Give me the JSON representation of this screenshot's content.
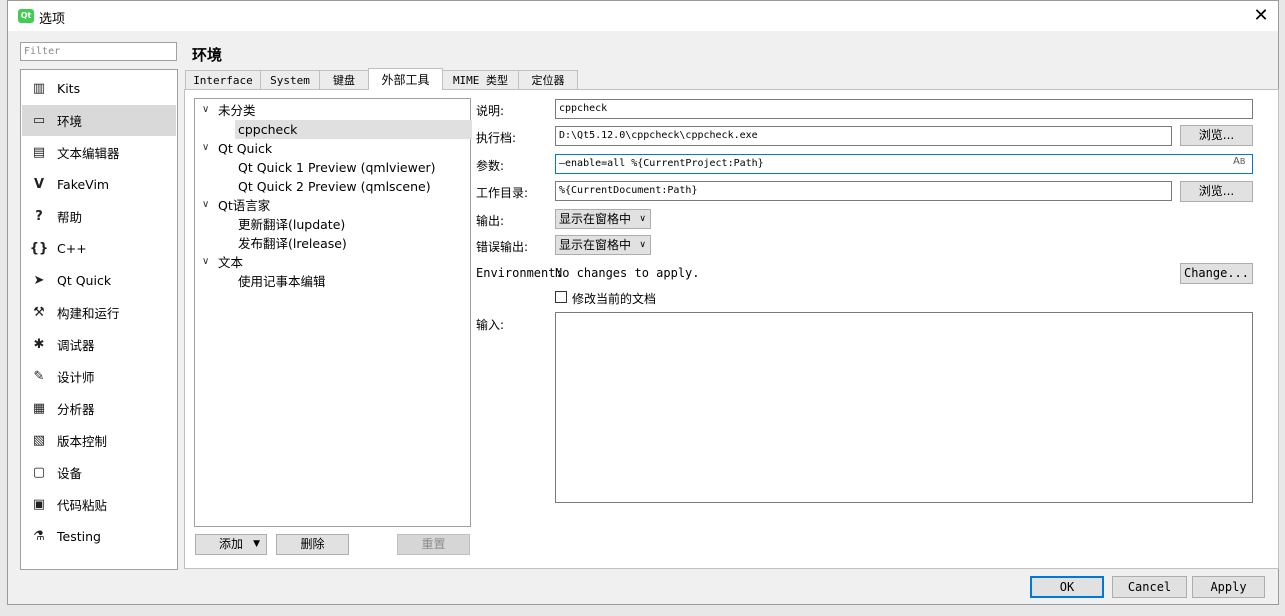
{
  "window": {
    "title": "选项",
    "app_icon": "qt-logo-icon",
    "close_icon": "close-icon"
  },
  "filter": {
    "placeholder": "Filter",
    "value": ""
  },
  "categories": [
    {
      "label": "Kits",
      "icon": "kits-icon",
      "glyph": "▥"
    },
    {
      "label": "环境",
      "icon": "monitor-icon",
      "glyph": "▭",
      "selected": true
    },
    {
      "label": "文本编辑器",
      "icon": "text-editor-icon",
      "glyph": "▤"
    },
    {
      "label": "FakeVim",
      "icon": "fakevim-icon",
      "glyph": "V"
    },
    {
      "label": "帮助",
      "icon": "help-icon",
      "glyph": "?"
    },
    {
      "label": "C++",
      "icon": "cpp-icon",
      "glyph": "{}"
    },
    {
      "label": "Qt Quick",
      "icon": "qt-quick-icon",
      "glyph": "➤"
    },
    {
      "label": "构建和运行",
      "icon": "hammer-icon",
      "glyph": "⚒"
    },
    {
      "label": "调试器",
      "icon": "bug-icon",
      "glyph": "✱"
    },
    {
      "label": "设计师",
      "icon": "pencil-icon",
      "glyph": "✎"
    },
    {
      "label": "分析器",
      "icon": "analyzer-icon",
      "glyph": "▦"
    },
    {
      "label": "版本控制",
      "icon": "version-control-icon",
      "glyph": "▧"
    },
    {
      "label": "设备",
      "icon": "device-icon",
      "glyph": "▢"
    },
    {
      "label": "代码粘贴",
      "icon": "clipboard-icon",
      "glyph": "▣"
    },
    {
      "label": "Testing",
      "icon": "testing-icon",
      "glyph": "⚗"
    }
  ],
  "page_title": "环境",
  "tabs": [
    {
      "label": "Interface"
    },
    {
      "label": "System"
    },
    {
      "label": "键盘"
    },
    {
      "label": "外部工具",
      "active": true
    },
    {
      "label": "MIME 类型"
    },
    {
      "label": "定位器"
    }
  ],
  "tree": {
    "groups": [
      {
        "label": "未分类",
        "children": [
          "cppcheck"
        ]
      },
      {
        "label": "Qt Quick",
        "children": [
          "Qt Quick 1 Preview (qmlviewer)",
          "Qt Quick 2 Preview (qmlscene)"
        ]
      },
      {
        "label": "Qt语言家",
        "children": [
          "更新翻译(lupdate)",
          "发布翻译(lrelease)"
        ]
      },
      {
        "label": "文本",
        "children": [
          "使用记事本编辑"
        ]
      }
    ],
    "selected": "cppcheck"
  },
  "tree_buttons": {
    "add": "添加",
    "delete": "删除",
    "reset": "重置"
  },
  "form": {
    "description_label": "说明:",
    "description_value": "cppcheck",
    "executable_label": "执行档:",
    "executable_value": "D:\\Qt5.12.0\\cppcheck\\cppcheck.exe",
    "browse_label": "浏览...",
    "args_label": "参数:",
    "args_value": "—enable=all %{CurrentProject:Path}",
    "workdir_label": "工作目录:",
    "workdir_value": "%{CurrentDocument:Path}",
    "output_label": "输出:",
    "output_value": "显示在窗格中",
    "error_output_label": "错误输出:",
    "error_output_value": "显示在窗格中",
    "environment_label": "Environment:",
    "environment_value": "No changes to apply.",
    "change_label": "Change...",
    "modify_doc_label": "修改当前的文档",
    "modify_doc_checked": false,
    "input_label": "输入:",
    "input_value": ""
  },
  "dialog_buttons": {
    "ok": "OK",
    "cancel": "Cancel",
    "apply": "Apply"
  },
  "colors": {
    "accent": "#0078d7",
    "selection": "#d9d9d9",
    "qt_green": "#41cd52"
  }
}
